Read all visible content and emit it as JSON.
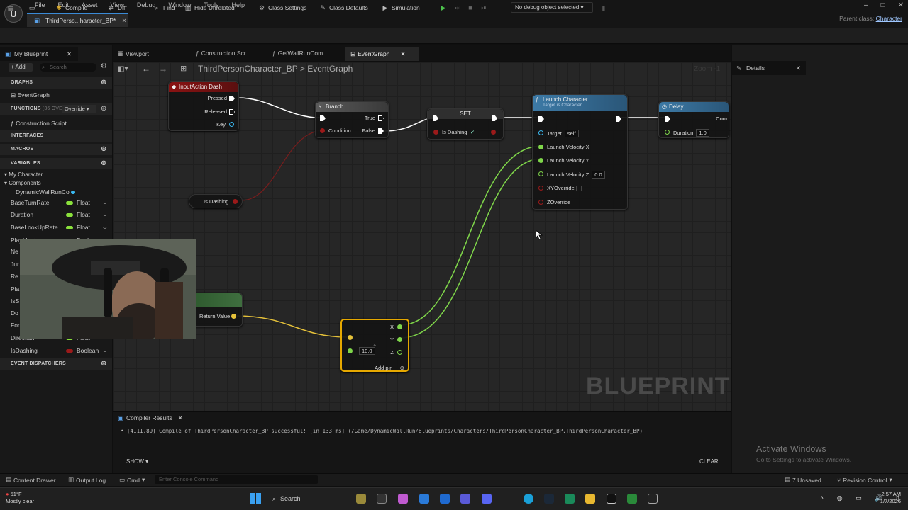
{
  "menu": {
    "items": [
      "File",
      "Edit",
      "Asset",
      "View",
      "Debug",
      "Window",
      "Tools",
      "Help"
    ],
    "doc_tab": "ThirdPerso...haracter_BP*",
    "parent_class_label": "Parent class:",
    "parent_class_value": "Character",
    "win_min": "–",
    "win_max": "□",
    "win_close": "✕"
  },
  "toolbar": {
    "save": "💾",
    "browse": "📁",
    "compile": "Compile",
    "diff": "Diff",
    "find": "Find",
    "hide_unrelated": "Hide Unrelated",
    "class_settings": "Class Settings",
    "class_defaults": "Class Defaults",
    "simulation": "Simulation",
    "debug_object": "No debug object selected"
  },
  "my_blueprint": {
    "tab": "My Blueprint",
    "add": "+ Add",
    "search_placeholder": "Search",
    "graphs_header": "GRAPHS",
    "event_graph": "EventGraph",
    "functions_header": "FUNCTIONS",
    "functions_count": "(36 OVE",
    "override": "Override",
    "construction_script": "Construction Script",
    "interfaces_header": "INTERFACES",
    "macros_header": "MACROS",
    "variables_header": "VARIABLES",
    "my_character": "My Character",
    "components": "Components",
    "component_item": "DynamicWallRunCo",
    "variables": [
      {
        "name": "BaseTurnRate",
        "type": "Float",
        "color": "#8ae03c"
      },
      {
        "name": "Duration",
        "type": "Float",
        "color": "#8ae03c"
      },
      {
        "name": "BaseLookUpRate",
        "type": "Float",
        "color": "#8ae03c"
      },
      {
        "name": "PlayMontage",
        "type": "Boolean",
        "color": "#9b1a1a"
      },
      {
        "name": "Ne",
        "type": "",
        "color": ""
      },
      {
        "name": "Jur",
        "type": "",
        "color": ""
      },
      {
        "name": "Re",
        "type": "",
        "color": ""
      },
      {
        "name": "Pla",
        "type": "",
        "color": ""
      },
      {
        "name": "IsS",
        "type": "",
        "color": ""
      },
      {
        "name": "Do",
        "type": "",
        "color": ""
      },
      {
        "name": "For",
        "type": "",
        "color": ""
      },
      {
        "name": "Direction",
        "type": "Float",
        "color": "#8ae03c"
      },
      {
        "name": "IsDashing",
        "type": "Boolean",
        "color": "#9b1a1a"
      }
    ],
    "event_dispatchers_header": "EVENT DISPATCHERS"
  },
  "graph_tabs": [
    "Viewport",
    "Construction Scr...",
    "GetWallRunCom...",
    "EventGraph"
  ],
  "breadcrumb": {
    "bp": "ThirdPersonCharacter_BP",
    "sep": ">",
    "graph": "EventGraph"
  },
  "zoom": "Zoom -1",
  "watermark": "BLUEPRINT",
  "nodes": {
    "input_action": {
      "title": "InputAction Dash",
      "pressed": "Pressed",
      "released": "Released",
      "key": "Key"
    },
    "branch": {
      "title": "Branch",
      "true_label": "True",
      "false_label": "False",
      "condition": "Condition"
    },
    "set": {
      "title": "SET",
      "is_dashing": "Is Dashing"
    },
    "launch": {
      "title": "Launch Character",
      "subtitle": "Target is Character",
      "target": "Target",
      "target_val": "self",
      "vx": "Launch Velocity X",
      "vy": "Launch Velocity Y",
      "vz": "Launch Velocity Z",
      "vz_val": "0.0",
      "xy": "XYOverride",
      "z": "ZOverride"
    },
    "delay": {
      "title": "Delay",
      "duration": "Duration",
      "duration_val": "1.0",
      "completed": "Com"
    },
    "get_isdashing": {
      "title": "Is Dashing"
    },
    "return_value": {
      "label": "Return Value"
    },
    "make_vector": {
      "x": "X",
      "y": "Y",
      "z": "Z",
      "in_val": "10.0",
      "add_pin": "Add pin"
    }
  },
  "compiler": {
    "tab": "Compiler Results",
    "message": "• [4111.89] Compile of ThirdPersonCharacter_BP successful! [in 133 ms] (/Game/DynamicWallRun/Blueprints/Characters/ThirdPersonCharacter_BP.ThirdPersonCharacter_BP)",
    "show": "SHOW",
    "clear": "CLEAR"
  },
  "details": {
    "tab": "Details"
  },
  "activate": {
    "title": "Activate Windows",
    "sub": "Go to Settings to activate Windows."
  },
  "statusbar": {
    "content_drawer": "Content Drawer",
    "output_log": "Output Log",
    "cmd": "Cmd",
    "console_placeholder": "Enter Console Command",
    "unsaved": "7 Unsaved",
    "revision": "Revision Control"
  },
  "taskbar": {
    "temp": "51°F",
    "weather": "Mostly clear",
    "search": "Search",
    "time": "2:57 AM",
    "date": "1/7/2026"
  }
}
